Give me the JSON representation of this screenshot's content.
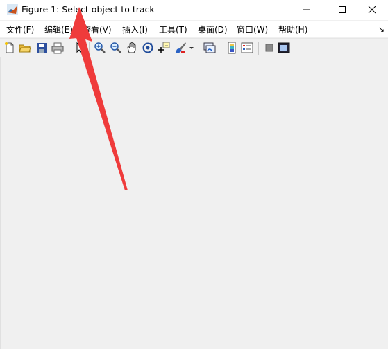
{
  "window": {
    "title": "Figure 1: Select object to track"
  },
  "menu": {
    "items": [
      {
        "label": "文件(F)"
      },
      {
        "label": "编辑(E)"
      },
      {
        "label": "查看(V)"
      },
      {
        "label": "插入(I)"
      },
      {
        "label": "工具(T)"
      },
      {
        "label": "桌面(D)"
      },
      {
        "label": "窗口(W)"
      },
      {
        "label": "帮助(H)"
      }
    ],
    "overflow": "↘"
  },
  "colors": {
    "annotation_arrow": "#ef3b3b",
    "background": "#f0f0f0"
  }
}
